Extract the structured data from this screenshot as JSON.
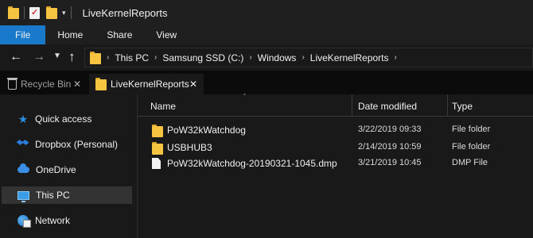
{
  "window": {
    "title": "LiveKernelReports"
  },
  "quick_access_toolbar": {
    "items": [
      {
        "icon": "folder-icon"
      },
      {
        "icon": "properties-icon"
      },
      {
        "icon": "new-folder-icon"
      },
      {
        "icon": "customize-dropdown-icon"
      }
    ]
  },
  "ribbon": {
    "tabs": [
      {
        "label": "File",
        "active": true
      },
      {
        "label": "Home"
      },
      {
        "label": "Share"
      },
      {
        "label": "View"
      }
    ],
    "accent_color": "#1979ca"
  },
  "navigation": {
    "back_glyph": "←",
    "forward_glyph": "→",
    "recent_glyph": "˅",
    "up_glyph": "↑"
  },
  "address_bar": {
    "breadcrumbs": [
      "This PC",
      "Samsung SSD (C:)",
      "Windows",
      "LiveKernelReports"
    ]
  },
  "tabs": [
    {
      "label": "Recycle Bin",
      "icon": "recycle-bin-icon",
      "active": false
    },
    {
      "label": "LiveKernelReports",
      "icon": "folder-icon",
      "active": true
    }
  ],
  "sidebar": {
    "items": [
      {
        "label": "Quick access",
        "icon": "star-icon"
      },
      {
        "label": "Dropbox (Personal)",
        "icon": "dropbox-icon"
      },
      {
        "label": "OneDrive",
        "icon": "cloud-icon"
      },
      {
        "label": "This PC",
        "icon": "pc-icon",
        "selected": true
      },
      {
        "label": "Network",
        "icon": "network-icon"
      }
    ]
  },
  "file_list": {
    "columns": {
      "name": "Name",
      "date": "Date modified",
      "type": "Type"
    },
    "rows": [
      {
        "name": "PoW32kWatchdog",
        "date": "3/22/2019 09:33",
        "type": "File folder",
        "icon": "folder-icon"
      },
      {
        "name": "USBHUB3",
        "date": "2/14/2019 10:59",
        "type": "File folder",
        "icon": "folder-icon"
      },
      {
        "name": "PoW32kWatchdog-20190321-1045.dmp",
        "date": "3/21/2019 10:45",
        "type": "DMP File",
        "icon": "file-icon"
      }
    ]
  }
}
